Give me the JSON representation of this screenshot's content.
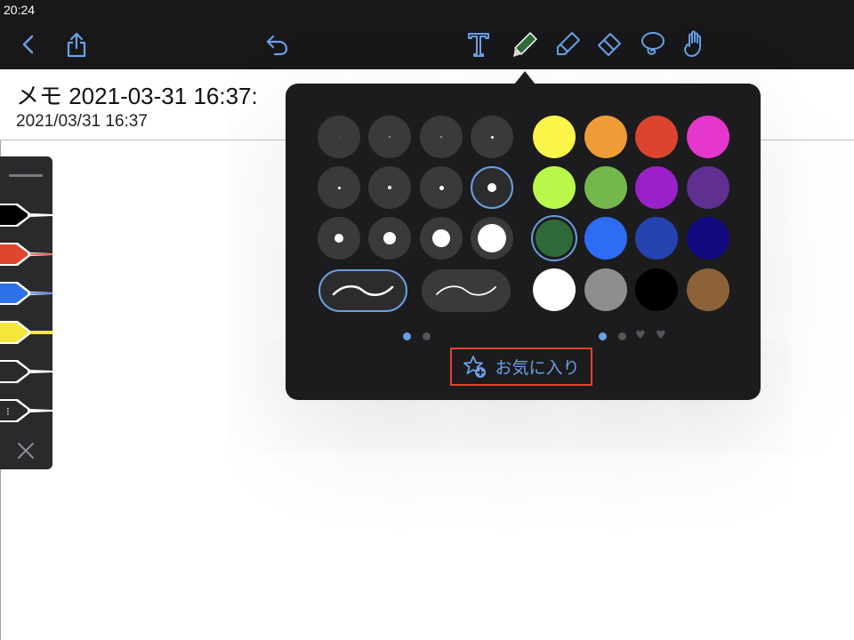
{
  "status_bar": {
    "time": "20:24"
  },
  "toolbar": {
    "back_icon": "chevron-left-icon",
    "share_icon": "share-icon",
    "undo_icon": "undo-icon",
    "tools": [
      "text-tool-icon",
      "pen-tool-icon",
      "highlighter-tool-icon",
      "eraser-tool-icon",
      "lasso-tool-icon",
      "hand-tool-icon"
    ],
    "active_tool": "pen",
    "accent_color": "#6aa0e6"
  },
  "note": {
    "title": "メモ 2021-03-31 16:37:",
    "date": "2021/03/31 16:37"
  },
  "pen_dock": {
    "pens": [
      {
        "name": "black-pen",
        "color": "#000000"
      },
      {
        "name": "red-pen",
        "color": "#e0452f"
      },
      {
        "name": "blue-pen",
        "color": "#2f6fe8"
      },
      {
        "name": "yellow-highlighter",
        "color": "#f6e63a"
      },
      {
        "name": "empty-pen-slot",
        "color": "#2a2a2d"
      },
      {
        "name": "empty-pen-slot-more",
        "color": "#2a2a2d"
      }
    ],
    "close_icon": "close-icon"
  },
  "pen_popover": {
    "sizes_selected_index": 7,
    "stroke_styles": [
      "smooth-stroke",
      "tapered-stroke"
    ],
    "stroke_selected_index": 0,
    "colors": [
      "#fbf54a",
      "#ee9d36",
      "#dd4430",
      "#e537cd",
      "#b9f74a",
      "#73b74d",
      "#9a21c7",
      "#5f2f92",
      "#2f6b3a",
      "#2f6cf5",
      "#2443b0",
      "#11097d",
      "#ffffff",
      "#8e8e8e",
      "#000000",
      "#8e6238"
    ],
    "color_selected_index": 8,
    "size_pages_active": 0,
    "color_pages_active": 0,
    "favorites_label": "お気に入り",
    "favorites_icon": "star-plus-icon"
  }
}
